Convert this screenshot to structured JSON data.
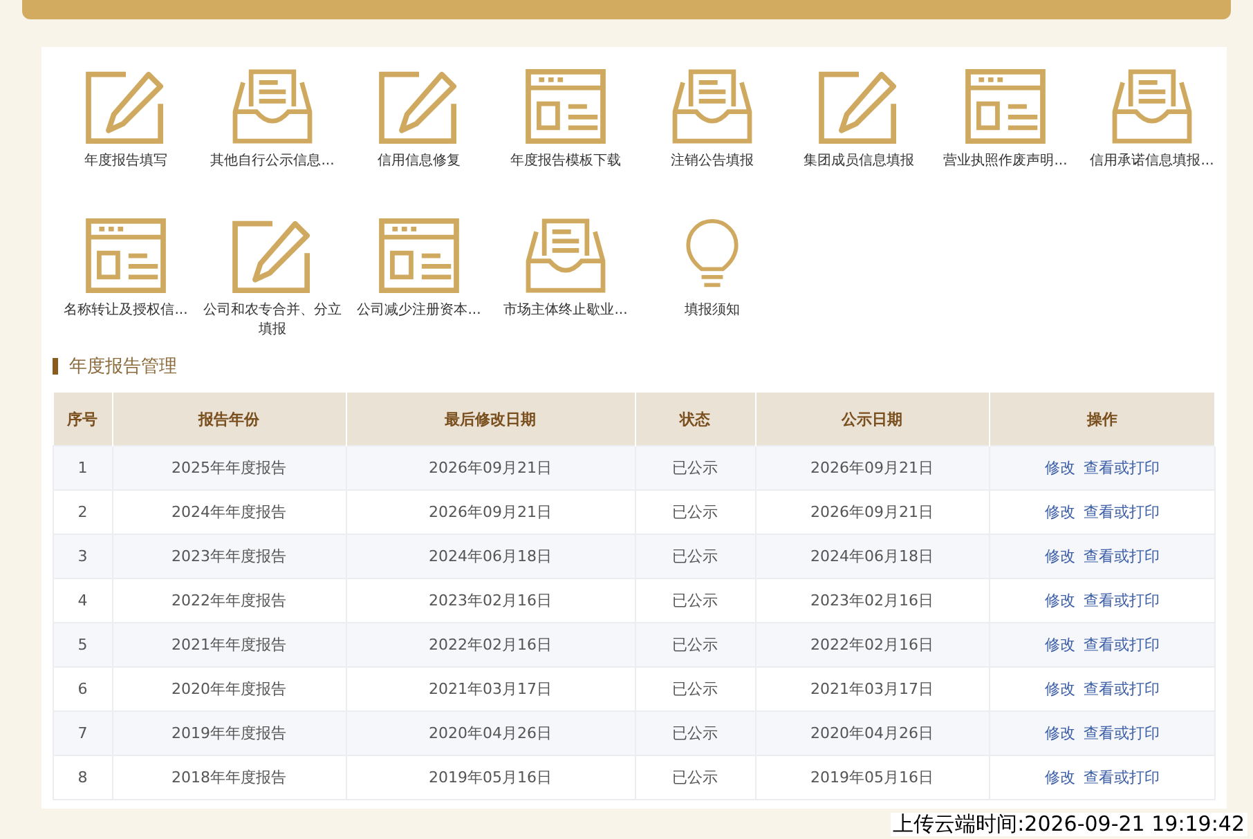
{
  "shortcuts": [
    {
      "label": "年度报告填写",
      "kind": "pencil"
    },
    {
      "label": "其他自行公示信息...",
      "kind": "tray"
    },
    {
      "label": "信用信息修复",
      "kind": "pencil"
    },
    {
      "label": "年度报告模板下载",
      "kind": "browser"
    },
    {
      "label": "注销公告填报",
      "kind": "tray"
    },
    {
      "label": "集团成员信息填报",
      "kind": "pencil"
    },
    {
      "label": "营业执照作废声明...",
      "kind": "browser"
    },
    {
      "label": "信用承诺信息填报...",
      "kind": "tray"
    },
    {
      "label": "名称转让及授权信...",
      "kind": "browser"
    },
    {
      "label": "公司和农专合并、分立填报",
      "kind": "pencil"
    },
    {
      "label": "公司减少注册资本...",
      "kind": "browser"
    },
    {
      "label": "市场主体终止歇业...",
      "kind": "tray"
    },
    {
      "label": "填报须知",
      "kind": "bulb"
    }
  ],
  "section_title": "年度报告管理",
  "table": {
    "columns": [
      "序号",
      "报告年份",
      "最后修改日期",
      "状态",
      "公示日期",
      "操作"
    ],
    "rows": [
      {
        "cells": [
          "1",
          "2025年年度报告",
          "2026年09月21日",
          "已公示",
          "2026年09月21日"
        ],
        "actions": [
          "修改",
          "查看或打印"
        ]
      },
      {
        "cells": [
          "2",
          "2024年年度报告",
          "2026年09月21日",
          "已公示",
          "2026年09月21日"
        ],
        "actions": [
          "修改",
          "查看或打印"
        ]
      },
      {
        "cells": [
          "3",
          "2023年年度报告",
          "2024年06月18日",
          "已公示",
          "2024年06月18日"
        ],
        "actions": [
          "修改",
          "查看或打印"
        ]
      },
      {
        "cells": [
          "4",
          "2022年年度报告",
          "2023年02月16日",
          "已公示",
          "2023年02月16日"
        ],
        "actions": [
          "修改",
          "查看或打印"
        ]
      },
      {
        "cells": [
          "5",
          "2021年年度报告",
          "2022年02月16日",
          "已公示",
          "2022年02月16日"
        ],
        "actions": [
          "修改",
          "查看或打印"
        ]
      },
      {
        "cells": [
          "6",
          "2020年年度报告",
          "2021年03月17日",
          "已公示",
          "2021年03月17日"
        ],
        "actions": [
          "修改",
          "查看或打印"
        ]
      },
      {
        "cells": [
          "7",
          "2019年年度报告",
          "2020年04月26日",
          "已公示",
          "2020年04月26日"
        ],
        "actions": [
          "修改",
          "查看或打印"
        ]
      },
      {
        "cells": [
          "8",
          "2018年年度报告",
          "2019年05月16日",
          "已公示",
          "2019年05月16日"
        ],
        "actions": [
          "修改",
          "查看或打印"
        ]
      }
    ]
  },
  "upload_stamp": "上传云端时间:2026-09-21 19:19:42"
}
